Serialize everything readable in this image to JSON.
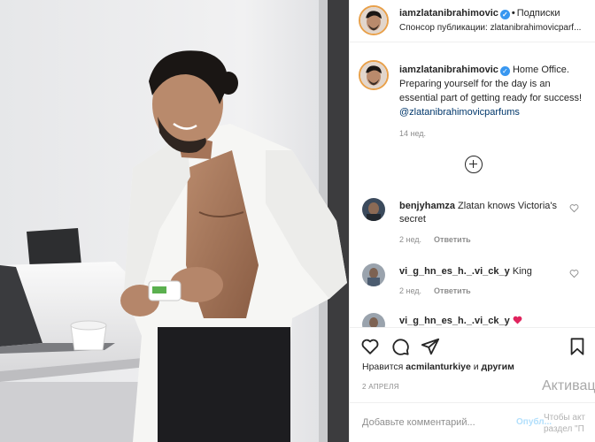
{
  "post": {
    "username": "iamzlatanibrahimovic",
    "follow_label": "Подписки",
    "sponsor_prefix": "Спонсор публикации:",
    "sponsor_name": "zlatanibrahimovicparf...",
    "caption_text": "Home Office. Preparing yourself for the day is an essential part of getting ready for success!",
    "caption_mention": "@zlatanibrahimovicparfums",
    "caption_time": "14 нед."
  },
  "comments": [
    {
      "user": "benjyhamza",
      "text": "Zlatan knows Victoria's secret",
      "time": "2 нед.",
      "reply": "Ответить"
    },
    {
      "user": "vi_g_hn_es_h._.vi_ck_y",
      "text": "King",
      "time": "2 нед.",
      "reply": "Ответить"
    },
    {
      "user": "vi_g_hn_es_h._.vi_ck_y",
      "text": ""
    }
  ],
  "actions": {
    "likes_prefix": "Нравится",
    "likes_user": "acmilanturkiye",
    "likes_conj": "и",
    "likes_others": "другим",
    "date": "2 АПРЕЛЯ",
    "comment_placeholder": "Добавьте комментарий...",
    "post_label": "Опубл..."
  },
  "watermark": {
    "title": "Активац",
    "line1": "Чтобы акт",
    "line2": "раздел \"П"
  },
  "colors": {
    "verified": "#3897f0",
    "mention": "#00376b",
    "muted": "#8e8e8e"
  }
}
